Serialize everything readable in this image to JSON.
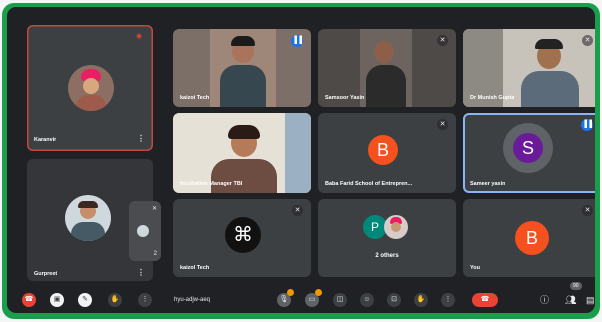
{
  "tiles": [
    {
      "name": "Karanvir",
      "id": "pinned-self"
    },
    {
      "name": "Gurpreet",
      "id": "left-second"
    },
    {
      "name": "kaizoi Tech",
      "id": "g1"
    },
    {
      "name": "Samsoor Yasin",
      "id": "g2"
    },
    {
      "name": "Dr Munish Gupta",
      "id": "g3"
    },
    {
      "name": "Incubation Manager TBI",
      "id": "g4"
    },
    {
      "name": "Baba Farid School of Entrepren...",
      "id": "g5",
      "initial": "B"
    },
    {
      "name": "Sameer yasin",
      "id": "g6",
      "initial": "S"
    },
    {
      "name": "kaizol Tech",
      "id": "g7"
    },
    {
      "name": "2 others",
      "id": "g8",
      "initial": "P"
    },
    {
      "name": "You",
      "id": "g9",
      "initial": "B"
    }
  ],
  "mini_tile_count": "2",
  "toolbar": {
    "meeting_code": "hyu-adjw-aeq",
    "people_count": "90"
  },
  "colors": {
    "frame": "#1a9e4b",
    "background": "#202124",
    "tile": "#3c4043",
    "avatar_orange": "#f4511e",
    "avatar_purple": "#6a1b9a",
    "avatar_teal": "#00897b",
    "end_call": "#ea4335",
    "active_speaker": "#8ab4f8"
  }
}
